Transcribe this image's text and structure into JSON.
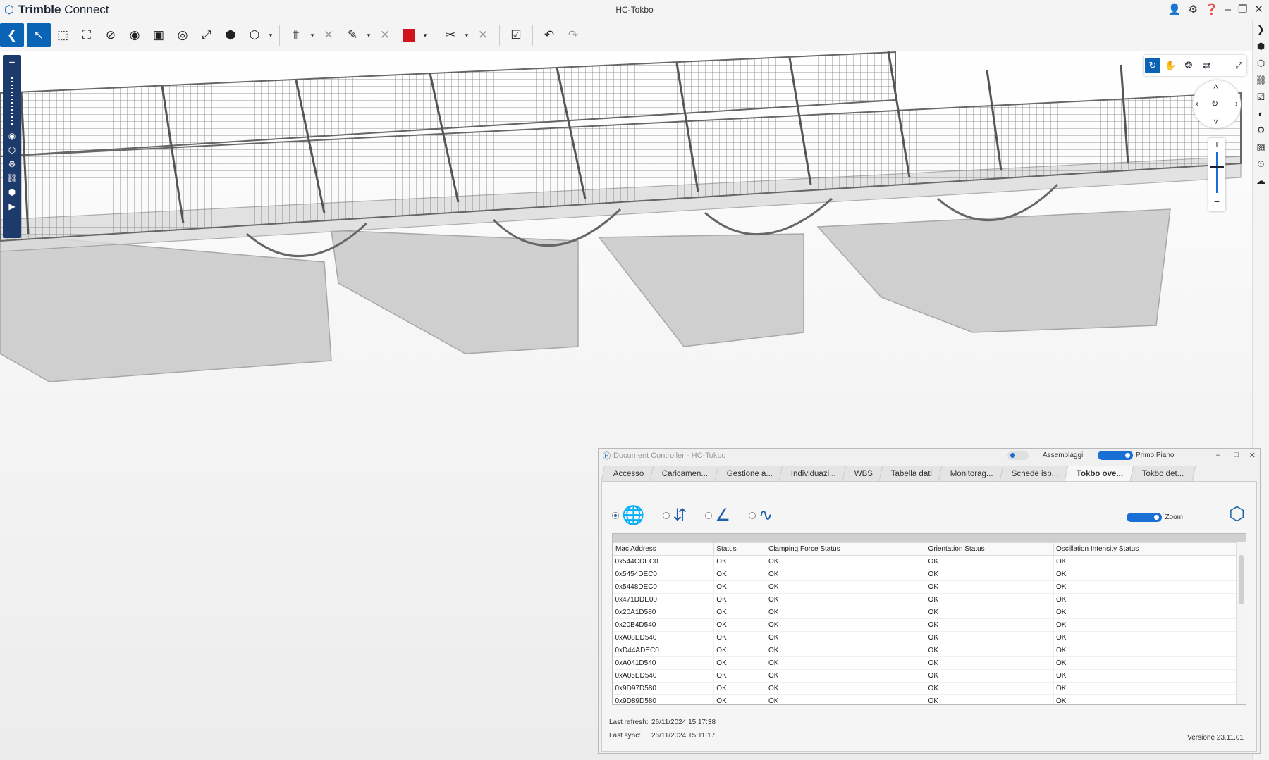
{
  "app": {
    "name_bold": "Trimble",
    "name_rest": "Connect",
    "project_title": "HC-Tokbo"
  },
  "toolbar": {
    "icons": [
      "back-arrow",
      "select-pointer",
      "box-select",
      "fit-view",
      "hide",
      "isolate",
      "section-plane",
      "visibility",
      "fullscreen",
      "object-add",
      "view-cube",
      "measure",
      "close",
      "markup-pen",
      "close",
      "color-swatch",
      "cut",
      "close",
      "clear-selection",
      "undo",
      "redo"
    ]
  },
  "accent": "#0b63b6",
  "dc": {
    "title": "Document Controller - HC-Tokbo",
    "toggle_assemblies": "Assemblaggi",
    "toggle_foreground": "Primo Piano",
    "tabs": [
      "Accesso",
      "Caricamen...",
      "Gestione a...",
      "Individuazi...",
      "WBS",
      "Tabella dati",
      "Monitorag...",
      "Schede isp...",
      "Tokbo ove...",
      "Tokbo det..."
    ],
    "active_tab": "Tokbo ove...",
    "zoom_label": "Zoom",
    "columns": [
      "Mac Address",
      "Status",
      "Clamping Force Status",
      "Orientation Status",
      "Oscillation Intensity Status"
    ],
    "rows": [
      [
        "0x544CDEC0",
        "OK",
        "OK",
        "OK",
        "OK"
      ],
      [
        "0x5454DEC0",
        "OK",
        "OK",
        "OK",
        "OK"
      ],
      [
        "0x5448DEC0",
        "OK",
        "OK",
        "OK",
        "OK"
      ],
      [
        "0x471DDE00",
        "OK",
        "OK",
        "OK",
        "OK"
      ],
      [
        "0x20A1D580",
        "OK",
        "OK",
        "OK",
        "OK"
      ],
      [
        "0x20B4D540",
        "OK",
        "OK",
        "OK",
        "OK"
      ],
      [
        "0xA08ED540",
        "OK",
        "OK",
        "OK",
        "OK"
      ],
      [
        "0xD44ADEC0",
        "OK",
        "OK",
        "OK",
        "OK"
      ],
      [
        "0xA041D540",
        "OK",
        "OK",
        "OK",
        "OK"
      ],
      [
        "0xA05ED540",
        "OK",
        "OK",
        "OK",
        "OK"
      ],
      [
        "0x9D97D580",
        "OK",
        "OK",
        "OK",
        "OK"
      ],
      [
        "0x9D89D580",
        "OK",
        "OK",
        "OK",
        "OK"
      ]
    ],
    "last_refresh_label": "Last refresh:",
    "last_refresh_value": "26/11/2024 15:17:38",
    "last_sync_label": "Last sync:",
    "last_sync_value": "26/11/2024 15:11:17",
    "version": "Versione 23.11.01"
  }
}
